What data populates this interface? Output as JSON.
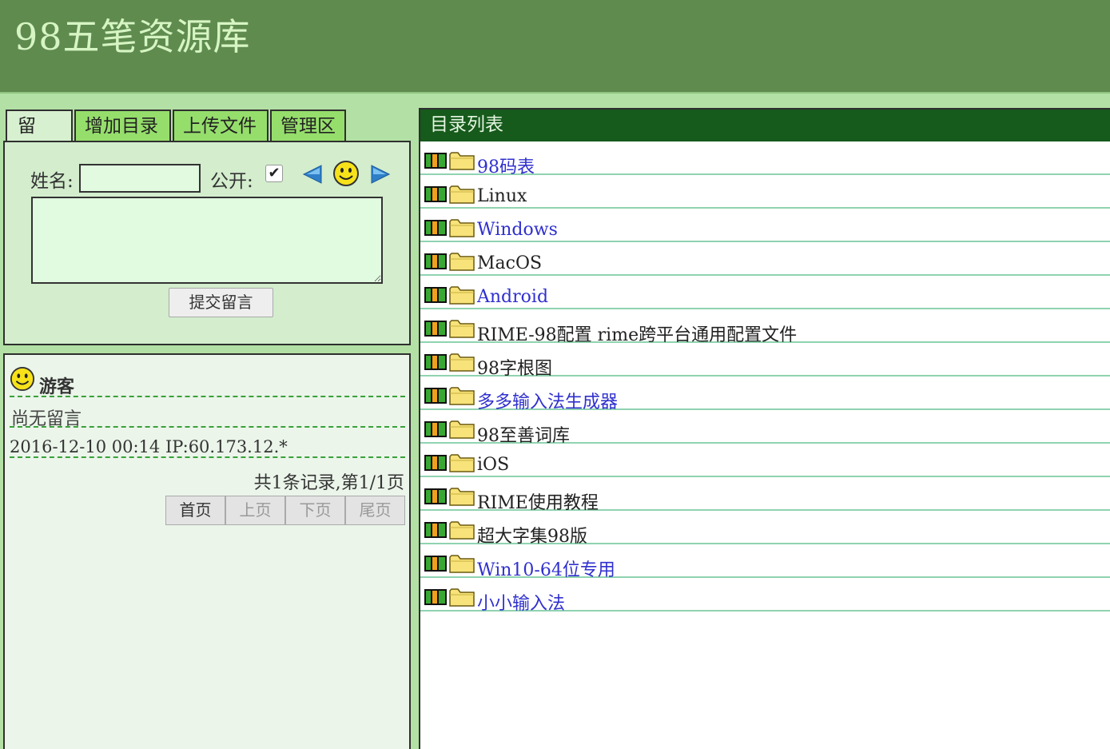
{
  "header": {
    "site_title": "98五笔资源库"
  },
  "tabs": [
    {
      "label": "留 言",
      "active": true
    },
    {
      "label": "增加目录",
      "active": false
    },
    {
      "label": "上传文件",
      "active": false
    },
    {
      "label": "管理区",
      "active": false
    }
  ],
  "form": {
    "name_label": "姓名:",
    "name_value": "",
    "public_label": "公开:",
    "public_checked": "✔",
    "submit_label": "提交留言"
  },
  "messages": {
    "author": "游客",
    "body": "尚无留言",
    "meta": "2016-12-10 00:14 IP:60.173.12.*",
    "pager_info": "共1条记录,第1/1页",
    "pager": [
      "首页",
      "上页",
      "下页",
      "尾页"
    ]
  },
  "directory": {
    "title": "目录列表",
    "items": [
      {
        "name": "98码表",
        "link": true
      },
      {
        "name": "Linux",
        "link": false
      },
      {
        "name": "Windows",
        "link": true
      },
      {
        "name": "MacOS",
        "link": false
      },
      {
        "name": "Android",
        "link": true
      },
      {
        "name": "RIME-98配置 rime跨平台通用配置文件",
        "link": false
      },
      {
        "name": "98字根图",
        "link": false
      },
      {
        "name": "多多输入法生成器",
        "link": true
      },
      {
        "name": "98至善词库",
        "link": false
      },
      {
        "name": "iOS",
        "link": false
      },
      {
        "name": "RIME使用教程",
        "link": false
      },
      {
        "name": "超大字集98版",
        "link": false
      },
      {
        "name": "Win10-64位专用",
        "link": true
      },
      {
        "name": "小小输入法",
        "link": true
      }
    ]
  },
  "colors": {
    "header_bg": "#5f8b4f",
    "page_bg": "#b3e0a5",
    "tab_bg": "#96de6c",
    "dir_header_bg": "#165a1c",
    "link": "#3030cf"
  },
  "icons": [
    "left-arrow-icon",
    "smiley-icon",
    "right-arrow-icon",
    "bar-icon",
    "folder-icon"
  ]
}
